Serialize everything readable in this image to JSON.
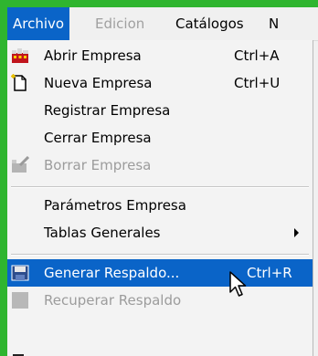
{
  "menubar": {
    "items": [
      {
        "label": "Archivo",
        "state": "active"
      },
      {
        "label": "Edicion",
        "state": "disabled"
      },
      {
        "label": "Catálogos",
        "state": "normal"
      },
      {
        "label": "N",
        "state": "normal"
      }
    ]
  },
  "menu": {
    "items": [
      {
        "label": "Abrir Empresa",
        "shortcut": "Ctrl+A",
        "icon": "open-company-icon",
        "state": "normal"
      },
      {
        "label": "Nueva Empresa",
        "shortcut": "Ctrl+U",
        "icon": "new-document-icon",
        "state": "normal"
      },
      {
        "label": "Registrar Empresa",
        "shortcut": "",
        "icon": "",
        "state": "normal"
      },
      {
        "label": "Cerrar Empresa",
        "shortcut": "",
        "icon": "",
        "state": "normal"
      },
      {
        "label": "Borrar Empresa",
        "shortcut": "",
        "icon": "delete-company-icon",
        "state": "disabled"
      },
      {
        "label": "Parámetros Empresa",
        "shortcut": "",
        "icon": "",
        "state": "normal"
      },
      {
        "label": "Tablas Generales",
        "shortcut": "",
        "icon": "",
        "state": "normal",
        "submenu": true
      },
      {
        "label": "Generar Respaldo...",
        "shortcut": "Ctrl+R",
        "icon": "backup-disk-icon",
        "state": "highlighted"
      },
      {
        "label": "Recuperar Respaldo",
        "shortcut": "",
        "icon": "restore-backup-icon",
        "state": "disabled"
      }
    ]
  },
  "colors": {
    "highlight": "#0a64c8",
    "border": "#2fb52f",
    "disabled_text": "#9c9c9c"
  }
}
